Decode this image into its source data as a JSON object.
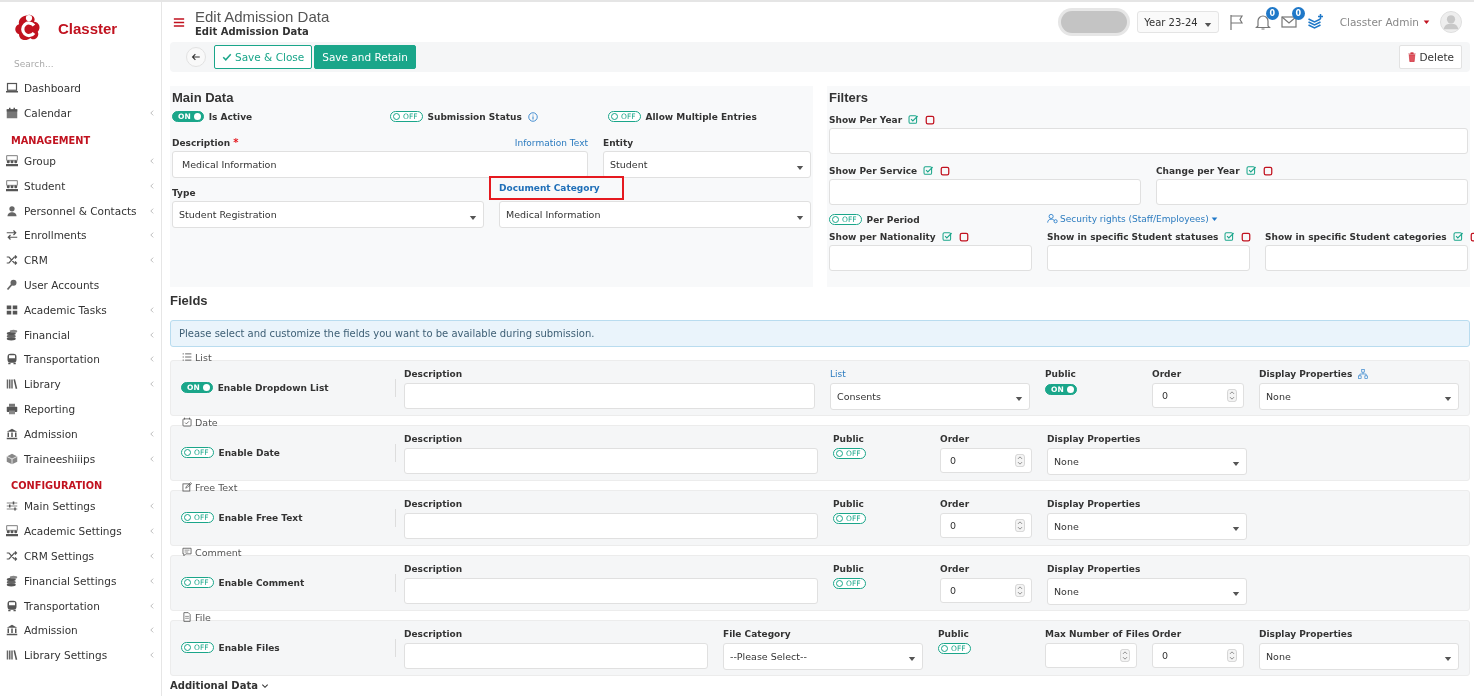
{
  "app": {
    "name": "Classter"
  },
  "sidebar": {
    "search": {
      "placeholder": "Search..."
    },
    "groups": [
      {
        "items": [
          {
            "label": "Dashboard",
            "has_submenu": false
          },
          {
            "label": "Calendar",
            "has_submenu": true
          }
        ]
      },
      {
        "heading": "MANAGEMENT",
        "items": [
          {
            "label": "Group",
            "has_submenu": true
          },
          {
            "label": "Student",
            "has_submenu": true
          },
          {
            "label": "Personnel & Contacts",
            "has_submenu": true
          },
          {
            "label": "Enrollments",
            "has_submenu": true
          },
          {
            "label": "CRM",
            "has_submenu": true
          },
          {
            "label": "User Accounts",
            "has_submenu": false
          },
          {
            "label": "Academic Tasks",
            "has_submenu": true
          },
          {
            "label": "Financial",
            "has_submenu": true
          },
          {
            "label": "Transportation",
            "has_submenu": true
          },
          {
            "label": "Library",
            "has_submenu": true
          },
          {
            "label": "Reporting",
            "has_submenu": false
          },
          {
            "label": "Admission",
            "has_submenu": true
          },
          {
            "label": "Traineeshiiips",
            "has_submenu": true
          }
        ]
      },
      {
        "heading": "CONFIGURATION",
        "items": [
          {
            "label": "Main Settings",
            "has_submenu": true
          },
          {
            "label": "Academic Settings",
            "has_submenu": true
          },
          {
            "label": "CRM Settings",
            "has_submenu": true
          },
          {
            "label": "Financial Settings",
            "has_submenu": true
          },
          {
            "label": "Transportation",
            "has_submenu": true
          },
          {
            "label": "Admission",
            "has_submenu": true
          },
          {
            "label": "Library Settings",
            "has_submenu": true
          }
        ]
      }
    ]
  },
  "header": {
    "title": "Edit Admission Data",
    "subtitle": "Edit Admission Data",
    "year": "Year 23-24",
    "notifications": "0",
    "messages": "0",
    "user": "Classter Admin"
  },
  "toolbar": {
    "buttons": [
      {
        "label": "Save & Close",
        "kind": "outline"
      },
      {
        "label": "Save and Retain",
        "kind": "primary"
      }
    ],
    "delete": "Delete"
  },
  "main_data": {
    "title": "Main Data",
    "toggles": [
      {
        "label": "Is Active",
        "on": true,
        "text": "ON",
        "info": false
      },
      {
        "label": "Submission Status",
        "on": false,
        "text": "OFF",
        "info": true
      },
      {
        "label": "Allow Multiple Entries",
        "on": false,
        "text": "OFF",
        "info": false
      }
    ],
    "description": {
      "label": "Description",
      "required_mark": "*",
      "link": "Information Text",
      "value": "Medical Information"
    },
    "entity": {
      "label": "Entity",
      "value": "Student",
      "highlighted": false
    },
    "type": {
      "label": "Type",
      "value": "Student Registration",
      "highlighted": false
    },
    "document_category": {
      "label": "Document Category",
      "value": "Medical Information",
      "highlighted": true
    }
  },
  "filters": {
    "title": "Filters",
    "rows": [
      {
        "kind": "fields",
        "items": [
          {
            "label": "Show Per Year"
          }
        ]
      },
      {
        "kind": "fields",
        "items": [
          {
            "label": "Show Per Service"
          },
          {
            "label": "Change per Year"
          }
        ]
      },
      {
        "kind": "options",
        "toggle": {
          "label": "Per Period",
          "on": false,
          "text": "OFF"
        },
        "link": "Security rights (Staff/Employees)"
      },
      {
        "kind": "fields",
        "items": [
          {
            "label": "Show per Nationality"
          },
          {
            "label": "Show in specific Student statuses"
          },
          {
            "label": "Show in specific Student categories"
          }
        ]
      }
    ]
  },
  "fields": {
    "title": "Fields",
    "info": "Please select and customize the fields you want to be available during submission.",
    "groups": [
      {
        "legend": "List",
        "toggle": {
          "label": "Enable Dropdown List",
          "on": true,
          "text": "ON"
        },
        "columns": [
          {
            "kind": "text",
            "label": "Description"
          },
          {
            "kind": "select",
            "label": "List",
            "label_link": true,
            "value": "Consents"
          },
          {
            "kind": "toggle",
            "label": "Public",
            "on": true,
            "text": "ON"
          },
          {
            "kind": "number",
            "label": "Order",
            "value": "0"
          },
          {
            "kind": "select",
            "label": "Display Properties",
            "label_icon": true,
            "value": "None"
          }
        ]
      },
      {
        "legend": "Date",
        "toggle": {
          "label": "Enable Date",
          "on": false,
          "text": "OFF"
        },
        "columns": [
          {
            "kind": "text",
            "label": "Description"
          },
          {
            "kind": "toggle",
            "label": "Public",
            "on": false,
            "text": "OFF"
          },
          {
            "kind": "number",
            "label": "Order",
            "value": "0"
          },
          {
            "kind": "select",
            "label": "Display Properties",
            "value": "None"
          }
        ]
      },
      {
        "legend": "Free Text",
        "toggle": {
          "label": "Enable Free Text",
          "on": false,
          "text": "OFF"
        },
        "columns": [
          {
            "kind": "text",
            "label": "Description"
          },
          {
            "kind": "toggle",
            "label": "Public",
            "on": false,
            "text": "OFF"
          },
          {
            "kind": "number",
            "label": "Order",
            "value": "0"
          },
          {
            "kind": "select",
            "label": "Display Properties",
            "value": "None"
          }
        ]
      },
      {
        "legend": "Comment",
        "toggle": {
          "label": "Enable Comment",
          "on": false,
          "text": "OFF"
        },
        "columns": [
          {
            "kind": "text",
            "label": "Description"
          },
          {
            "kind": "toggle",
            "label": "Public",
            "on": false,
            "text": "OFF"
          },
          {
            "kind": "number",
            "label": "Order",
            "value": "0"
          },
          {
            "kind": "select",
            "label": "Display Properties",
            "value": "None"
          }
        ]
      },
      {
        "legend": "File",
        "toggle": {
          "label": "Enable Files",
          "on": false,
          "text": "OFF"
        },
        "columns": [
          {
            "kind": "text",
            "label": "Description"
          },
          {
            "kind": "select",
            "label": "File Category",
            "value": "--Please Select--"
          },
          {
            "kind": "toggle",
            "label": "Public",
            "on": false,
            "text": "OFF"
          },
          {
            "kind": "number",
            "label": "Max Number of Files"
          },
          {
            "kind": "number",
            "label": "Order",
            "value": "0"
          },
          {
            "kind": "select",
            "label": "Display Properties",
            "value": "None"
          }
        ]
      }
    ]
  },
  "footer": {
    "section": "Additional Data"
  }
}
